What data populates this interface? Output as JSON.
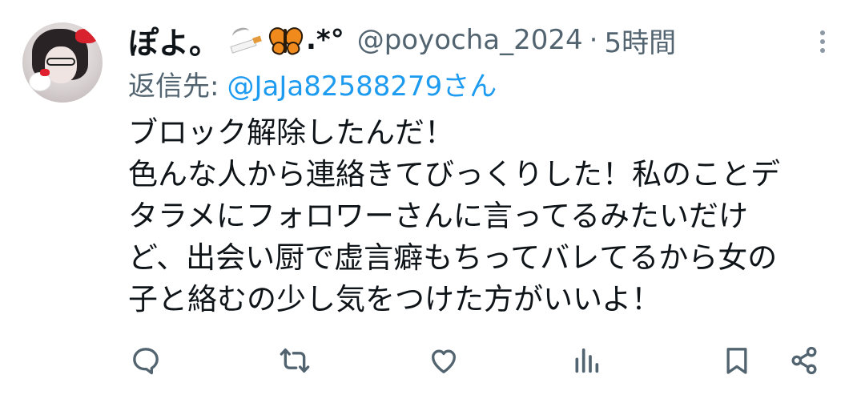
{
  "tweet": {
    "display_name": "ぽよ。",
    "name_emojis": [
      "cigarette-emoji",
      "butterfly-emoji"
    ],
    "name_deco": ".*°",
    "handle": "@poyocha_2024",
    "separator": "·",
    "time": "5時間",
    "reply_label": "返信先:",
    "reply_target": "@JaJa82588279さん",
    "body_lines": [
      "ブロック解除したんだ！",
      "色んな人から連絡きてびっくりした！私のことデ",
      "タラメにフォロワーさんに言ってるみたいだけ",
      "ど、出会い厨で虚言癖もちってバレてるから女の",
      "子と絡むの少し気をつけた方がいいよ！"
    ]
  },
  "actions": [
    {
      "name": "reply-icon"
    },
    {
      "name": "retweet-icon"
    },
    {
      "name": "like-icon"
    },
    {
      "name": "views-icon"
    },
    {
      "name": "bookmark-icon"
    },
    {
      "name": "share-icon"
    }
  ],
  "colors": {
    "text": "#0f1419",
    "secondary": "#536471",
    "link": "#1d9bf0",
    "icon": "#536471"
  }
}
